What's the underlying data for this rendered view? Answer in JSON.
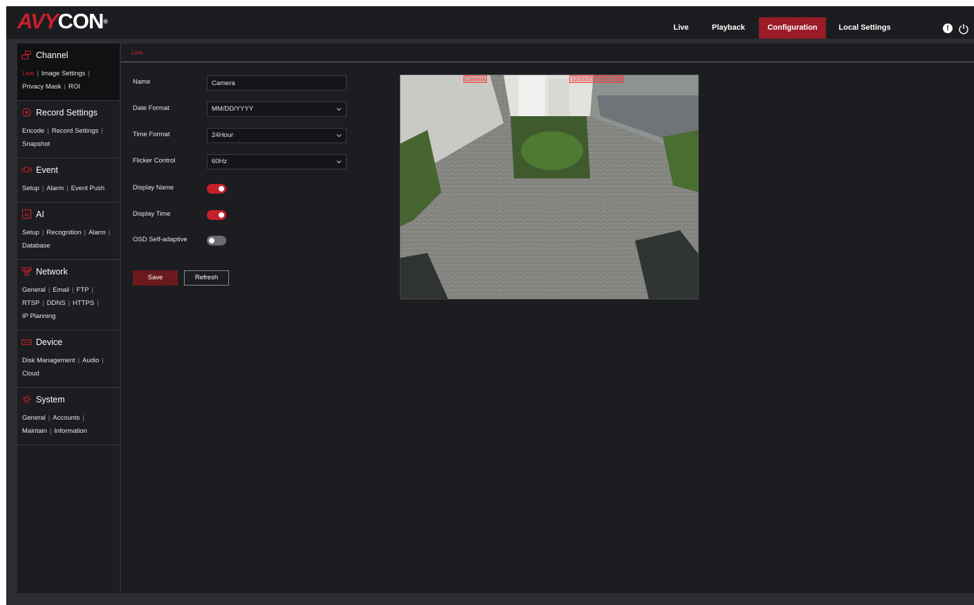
{
  "brand": {
    "logo_red": "AVY",
    "logo_white": "CON",
    "reg": "®"
  },
  "topnav": {
    "live": "Live",
    "playback": "Playback",
    "configuration": "Configuration",
    "local_settings": "Local Settings"
  },
  "top_icons": {
    "info": "!"
  },
  "sidebar": {
    "channel": {
      "title": "Channel",
      "links": [
        "Live",
        "Image Settings",
        "Privacy Mask",
        "ROI"
      ]
    },
    "record": {
      "title": "Record Settings",
      "links": [
        "Encode",
        "Record Settings",
        "Snapshot"
      ]
    },
    "event": {
      "title": "Event",
      "links": [
        "Setup",
        "Alarm",
        "Event Push"
      ]
    },
    "ai": {
      "title": "AI",
      "links": [
        "Setup",
        "Recognition",
        "Alarm",
        "Database"
      ]
    },
    "network": {
      "title": "Network",
      "links": [
        "General",
        "Email",
        "FTP",
        "RTSP",
        "DDNS",
        "HTTPS",
        "IP Planning"
      ]
    },
    "device": {
      "title": "Device",
      "links": [
        "Disk Management",
        "Audio",
        "Cloud"
      ]
    },
    "system": {
      "title": "System",
      "links": [
        "General",
        "Accounts",
        "Maintain",
        "Information"
      ]
    }
  },
  "content": {
    "tab": "Live",
    "form": {
      "name_label": "Name",
      "name_value": "Camera",
      "date_format_label": "Date Format",
      "date_format_value": "MM/DD/YYYY",
      "time_format_label": "Time Format",
      "time_format_value": "24Hour",
      "flicker_label": "Flicker Control",
      "flicker_value": "60Hz",
      "display_name_label": "Display Name",
      "display_name_on": true,
      "display_time_label": "Display Time",
      "display_time_on": true,
      "osd_label": "OSD Self-adaptive",
      "osd_on": false
    },
    "buttons": {
      "save": "Save",
      "refresh": "Refresh"
    },
    "preview": {
      "osd_name": "Camera",
      "osd_time": "12/30/2022 09:24:48"
    }
  },
  "colors": {
    "accent": "#9b1b26",
    "active_link": "#c8202a",
    "toggle_on": "#c8202a",
    "toggle_off": "#6b6d73"
  }
}
